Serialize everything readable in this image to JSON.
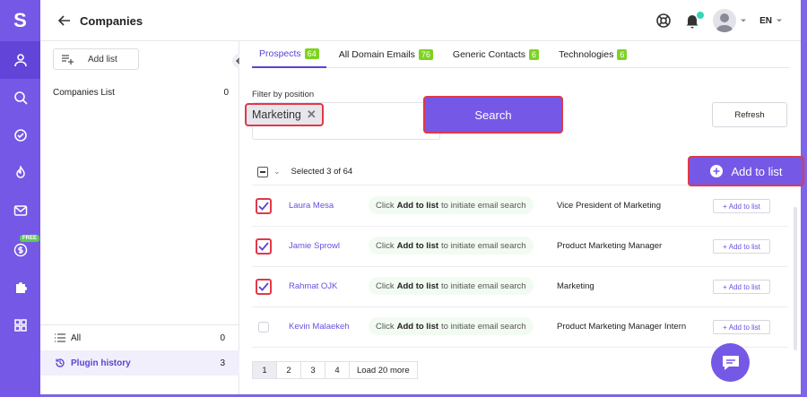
{
  "nav": {
    "logo": "S",
    "free_badge": "FREE",
    "items": [
      "user-icon",
      "search-icon",
      "check-circle-icon",
      "fire-icon",
      "mail-icon",
      "dollar-icon",
      "puzzle-icon",
      "grid-icon"
    ]
  },
  "header": {
    "title": "Companies",
    "language": "EN"
  },
  "sidebar": {
    "add_list_label": "Add list",
    "companies_list": {
      "label": "Companies List",
      "count": "0"
    },
    "bottom": [
      {
        "label": "All",
        "count": "0"
      },
      {
        "label": "Plugin history",
        "count": "3"
      }
    ]
  },
  "tabs": [
    {
      "label": "Prospects",
      "count": "64"
    },
    {
      "label": "All Domain Emails",
      "count": "76"
    },
    {
      "label": "Generic Contacts",
      "count": "6"
    },
    {
      "label": "Technologies",
      "count": "6"
    }
  ],
  "filter": {
    "label": "Filter by position",
    "chip": "Marketing",
    "search_label": "Search",
    "refresh_label": "Refresh"
  },
  "table": {
    "selected_text": "Selected 3 of 64",
    "add_to_list_label": "Add to list",
    "rows": [
      {
        "name": "Laura Mesa",
        "hint_pre": "Click",
        "hint_bold": "Add to list",
        "hint_post": "to initiate email search",
        "position": "Vice President of Marketing",
        "action": "Add to list",
        "checked": true
      },
      {
        "name": "Jamie Sprowl",
        "hint_pre": "Click",
        "hint_bold": "Add to list",
        "hint_post": "to initiate email search",
        "position": "Product Marketing Manager",
        "action": "Add to list",
        "checked": true
      },
      {
        "name": "Rahmat OJK",
        "hint_pre": "Click",
        "hint_bold": "Add to list",
        "hint_post": "to initiate email search",
        "position": "Marketing",
        "action": "Add to list",
        "checked": true
      },
      {
        "name": "Kevin Malaekeh",
        "hint_pre": "Click",
        "hint_bold": "Add to list",
        "hint_post": "to initiate email search",
        "position": "Product Marketing Manager Intern",
        "action": "Add to list",
        "checked": false
      }
    ]
  },
  "pagination": {
    "pages": [
      "1",
      "2",
      "3",
      "4"
    ],
    "load_more": "Load 20 more"
  },
  "colors": {
    "accent": "#7558e6",
    "highlight": "#e0394a",
    "badge_green": "#7ed321"
  }
}
